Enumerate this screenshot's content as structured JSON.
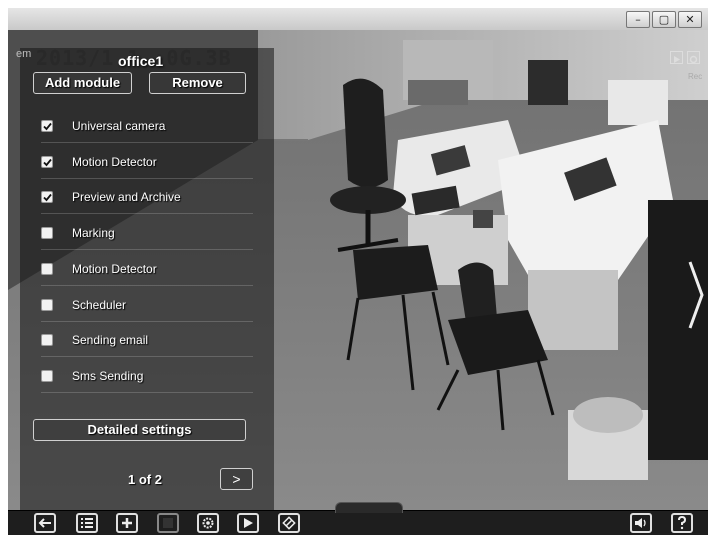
{
  "window": {
    "controls": [
      "–",
      "▢",
      "✕"
    ]
  },
  "overlay": {
    "camera_title": "office1",
    "timestamp": "2013/1  1  :0G.3B",
    "camera_label": "em"
  },
  "panel": {
    "add_module_label": "Add module",
    "remove_label": "Remove",
    "modules": [
      {
        "label": "Universal camera",
        "checked": true
      },
      {
        "label": "Motion Detector",
        "checked": true
      },
      {
        "label": "Preview and Archive",
        "checked": true
      },
      {
        "label": "Marking",
        "checked": false
      },
      {
        "label": "Motion Detector",
        "checked": false
      },
      {
        "label": "Scheduler",
        "checked": false
      },
      {
        "label": "Sending email",
        "checked": false
      },
      {
        "label": "Sms Sending",
        "checked": false
      }
    ],
    "detailed_settings_label": "Detailed settings",
    "pager": "1 of 2",
    "next_label": ">"
  },
  "top_right": {
    "rec_label": "Rec"
  },
  "toolbar": {
    "icons": [
      "back-icon",
      "list-icon",
      "add-icon",
      "stop-icon",
      "settings-icon",
      "play-icon",
      "rotate-icon",
      "sound-icon",
      "help-icon"
    ]
  }
}
